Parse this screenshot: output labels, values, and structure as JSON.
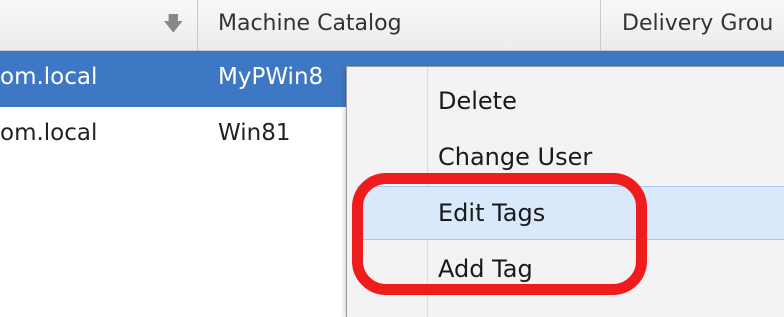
{
  "table": {
    "sort_icon": "down-arrow-icon",
    "columns": [
      "Machine Catalog",
      "Delivery Grou"
    ],
    "rows": [
      {
        "name": "om.local",
        "catalog": "MyPWin8",
        "selected": true
      },
      {
        "name": "om.local",
        "catalog": "Win81",
        "selected": false
      }
    ]
  },
  "context_menu": {
    "items": [
      "Delete",
      "Change User",
      "Edit Tags",
      "Add Tag"
    ],
    "hovered": "Edit Tags"
  },
  "annotation": {
    "color": "#ee1c1c",
    "target": "Edit Tags, Add Tag"
  },
  "colors": {
    "selection": "#3e78c4",
    "menu_hover": "#d9e8fb",
    "header": "#ececec"
  }
}
